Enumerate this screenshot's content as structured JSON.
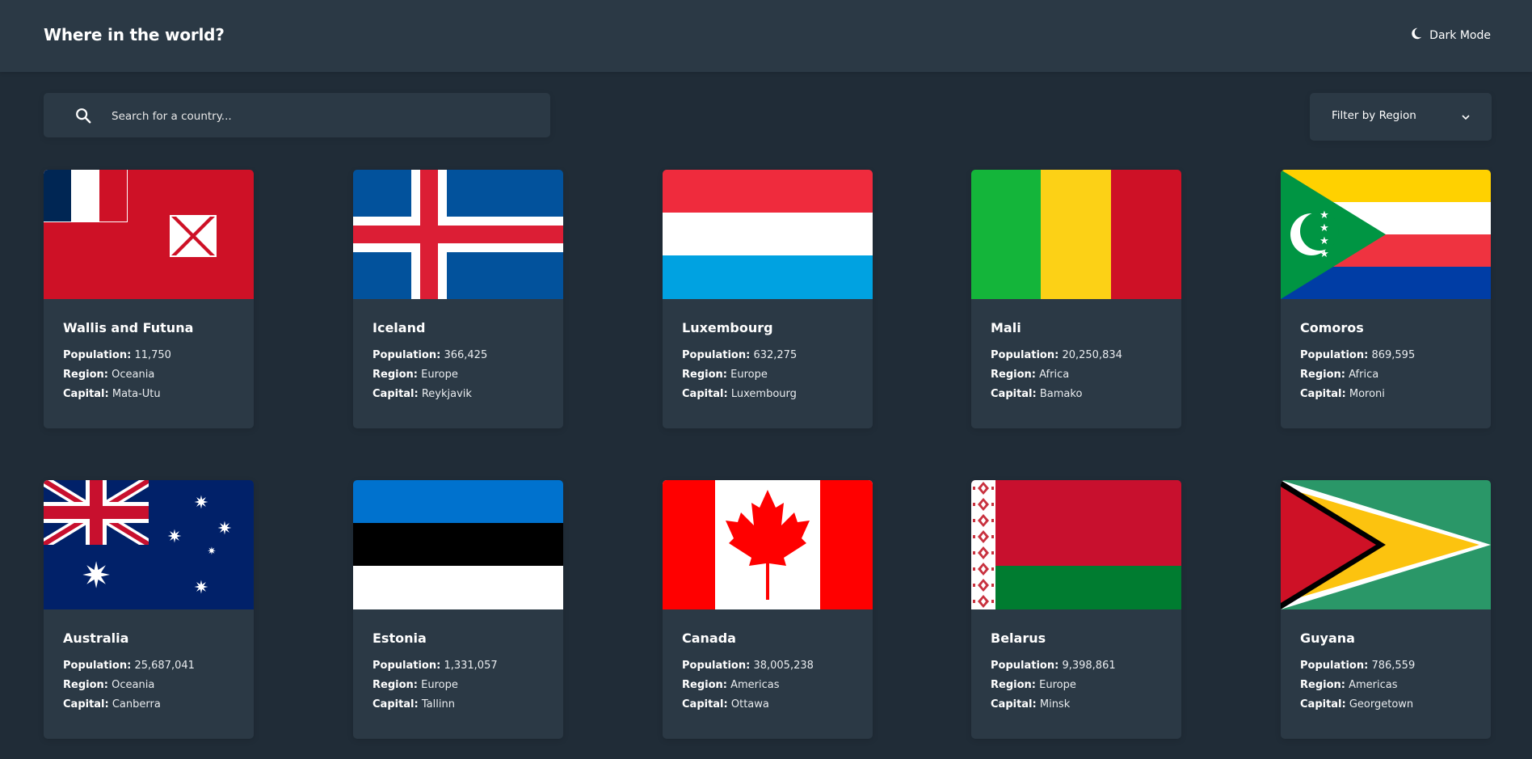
{
  "header": {
    "title": "Where in the world?",
    "mode_label": "Dark Mode",
    "mode_icon": "moon-icon"
  },
  "search": {
    "placeholder": "Search for a country...",
    "icon": "search-icon"
  },
  "filter": {
    "label": "Filter by Region",
    "icon": "chevron-down-icon"
  },
  "labels": {
    "population": "Population:",
    "region": "Region:",
    "capital": "Capital:"
  },
  "colors": {
    "background": "#202c37",
    "elements": "#2b3945",
    "text": "#ffffff"
  },
  "countries": [
    {
      "name": "Wallis and Futuna",
      "population": "11,750",
      "region": "Oceania",
      "capital": "Mata-Utu",
      "flag": "wallis-futuna-flag"
    },
    {
      "name": "Iceland",
      "population": "366,425",
      "region": "Europe",
      "capital": "Reykjavik",
      "flag": "iceland-flag"
    },
    {
      "name": "Luxembourg",
      "population": "632,275",
      "region": "Europe",
      "capital": "Luxembourg",
      "flag": "luxembourg-flag"
    },
    {
      "name": "Mali",
      "population": "20,250,834",
      "region": "Africa",
      "capital": "Bamako",
      "flag": "mali-flag"
    },
    {
      "name": "Comoros",
      "population": "869,595",
      "region": "Africa",
      "capital": "Moroni",
      "flag": "comoros-flag"
    },
    {
      "name": "Australia",
      "population": "25,687,041",
      "region": "Oceania",
      "capital": "Canberra",
      "flag": "australia-flag"
    },
    {
      "name": "Estonia",
      "population": "1,331,057",
      "region": "Europe",
      "capital": "Tallinn",
      "flag": "estonia-flag"
    },
    {
      "name": "Canada",
      "population": "38,005,238",
      "region": "Americas",
      "capital": "Ottawa",
      "flag": "canada-flag"
    },
    {
      "name": "Belarus",
      "population": "9,398,861",
      "region": "Europe",
      "capital": "Minsk",
      "flag": "belarus-flag"
    },
    {
      "name": "Guyana",
      "population": "786,559",
      "region": "Americas",
      "capital": "Georgetown",
      "flag": "guyana-flag"
    }
  ]
}
